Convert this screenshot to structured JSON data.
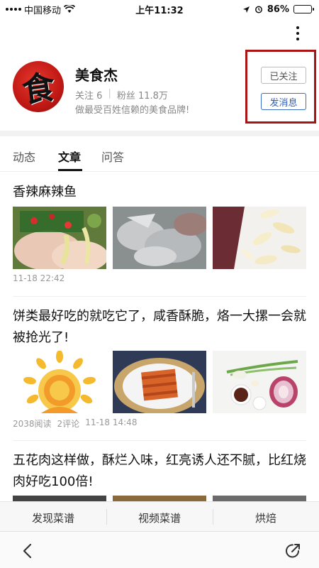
{
  "status_bar": {
    "carrier": "中国移动",
    "time": "上午11:32",
    "battery": "86%",
    "battery_level": 0.86
  },
  "profile": {
    "avatar_char": "食",
    "name": "美食杰",
    "follow_label": "关注",
    "follow_count": "6",
    "fans_label": "粉丝",
    "fans_count": "11.8万",
    "bio": "做最受百姓信赖的美食品牌!",
    "followed_button": "已关注",
    "message_button": "发消息"
  },
  "tabs": [
    {
      "label": "动态",
      "active": false
    },
    {
      "label": "文章",
      "active": true
    },
    {
      "label": "问答",
      "active": false
    }
  ],
  "articles": [
    {
      "title": "香辣麻辣鱼",
      "images": [
        "raw fish with chili and scallion",
        "sliced fish fillets",
        "garlic slices"
      ],
      "time": "11-18 22:42"
    },
    {
      "title": "饼类最好吃的就吃它了，咸香酥脆，烙一大摞一会就被抢光了!",
      "images": [
        "sun illustration",
        "layered pancake on plate",
        "ingredients: scallion, sauce, onion"
      ],
      "reads": "2038阅读",
      "comments": "2评论",
      "time": "11-18 14:48"
    },
    {
      "title": "五花肉这样做，酥烂入味，红亮诱人还不腻，比红烧肉好吃100倍!"
    }
  ],
  "bottom_tabs": [
    "发现菜谱",
    "视频菜谱",
    "烘焙"
  ],
  "icons": {
    "more": "more-icon",
    "back": "back-icon",
    "share": "share-icon"
  },
  "colors": {
    "highlight_border": "#a91515",
    "message_button": "#2f5fb8",
    "avatar_red": "#c01814"
  }
}
